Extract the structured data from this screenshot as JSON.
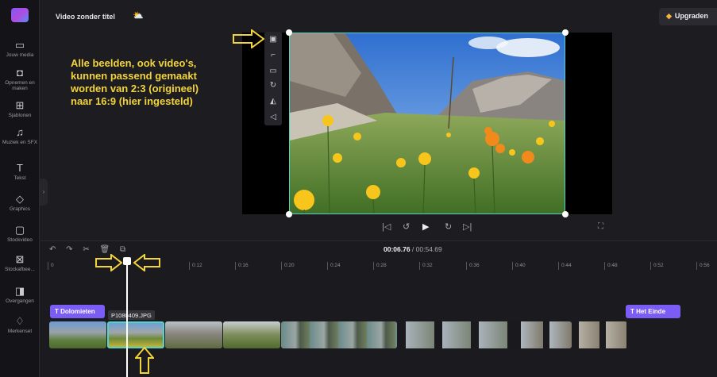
{
  "window": {
    "title": "Video zonder titel"
  },
  "header": {
    "upgrade_label": "Upgraden"
  },
  "sidebar": {
    "items": [
      {
        "label": "Jouw media",
        "icon": "folder-icon"
      },
      {
        "label": "Opnemen en maken",
        "icon": "camera-icon"
      },
      {
        "label": "Sjablonen",
        "icon": "templates-icon"
      },
      {
        "label": "Muziek en SFX",
        "icon": "music-icon"
      },
      {
        "label": "Tekst",
        "icon": "text-icon"
      },
      {
        "label": "Graphics",
        "icon": "shapes-icon"
      },
      {
        "label": "Stockvideo",
        "icon": "film-icon"
      },
      {
        "label": "Stockafbee...",
        "icon": "image-icon"
      },
      {
        "label": "Overgangen",
        "icon": "transition-icon"
      },
      {
        "label": "Merkenset",
        "icon": "brand-icon"
      }
    ]
  },
  "annotation": {
    "text": "Alle beelden, ook video's,\nkunnen passend gemaakt\nworden van 2:3 (origineel)\nnaar 16:9 (hier ingesteld)"
  },
  "canvas_tools": [
    "fit-icon",
    "crop-icon",
    "pip-icon",
    "rotate-icon",
    "flip-icon",
    "adjust-icon"
  ],
  "timeline": {
    "current_time": "00:06.76",
    "separator": " / ",
    "total_time": "00:54.69",
    "ruler": [
      "0",
      "0:12",
      "0:16",
      "0:20",
      "0:24",
      "0:28",
      "0:32",
      "0:36",
      "0:40",
      "0:44",
      "0:48",
      "0:52",
      "0:56"
    ],
    "text_clip_1": "Dolomieten",
    "text_clip_2": "Het Einde",
    "selected_clip_name": "P1080409.JPG"
  },
  "colors": {
    "accent": "#7b5cf5",
    "selection": "#53d3c9",
    "annotation": "#f3d43a"
  }
}
